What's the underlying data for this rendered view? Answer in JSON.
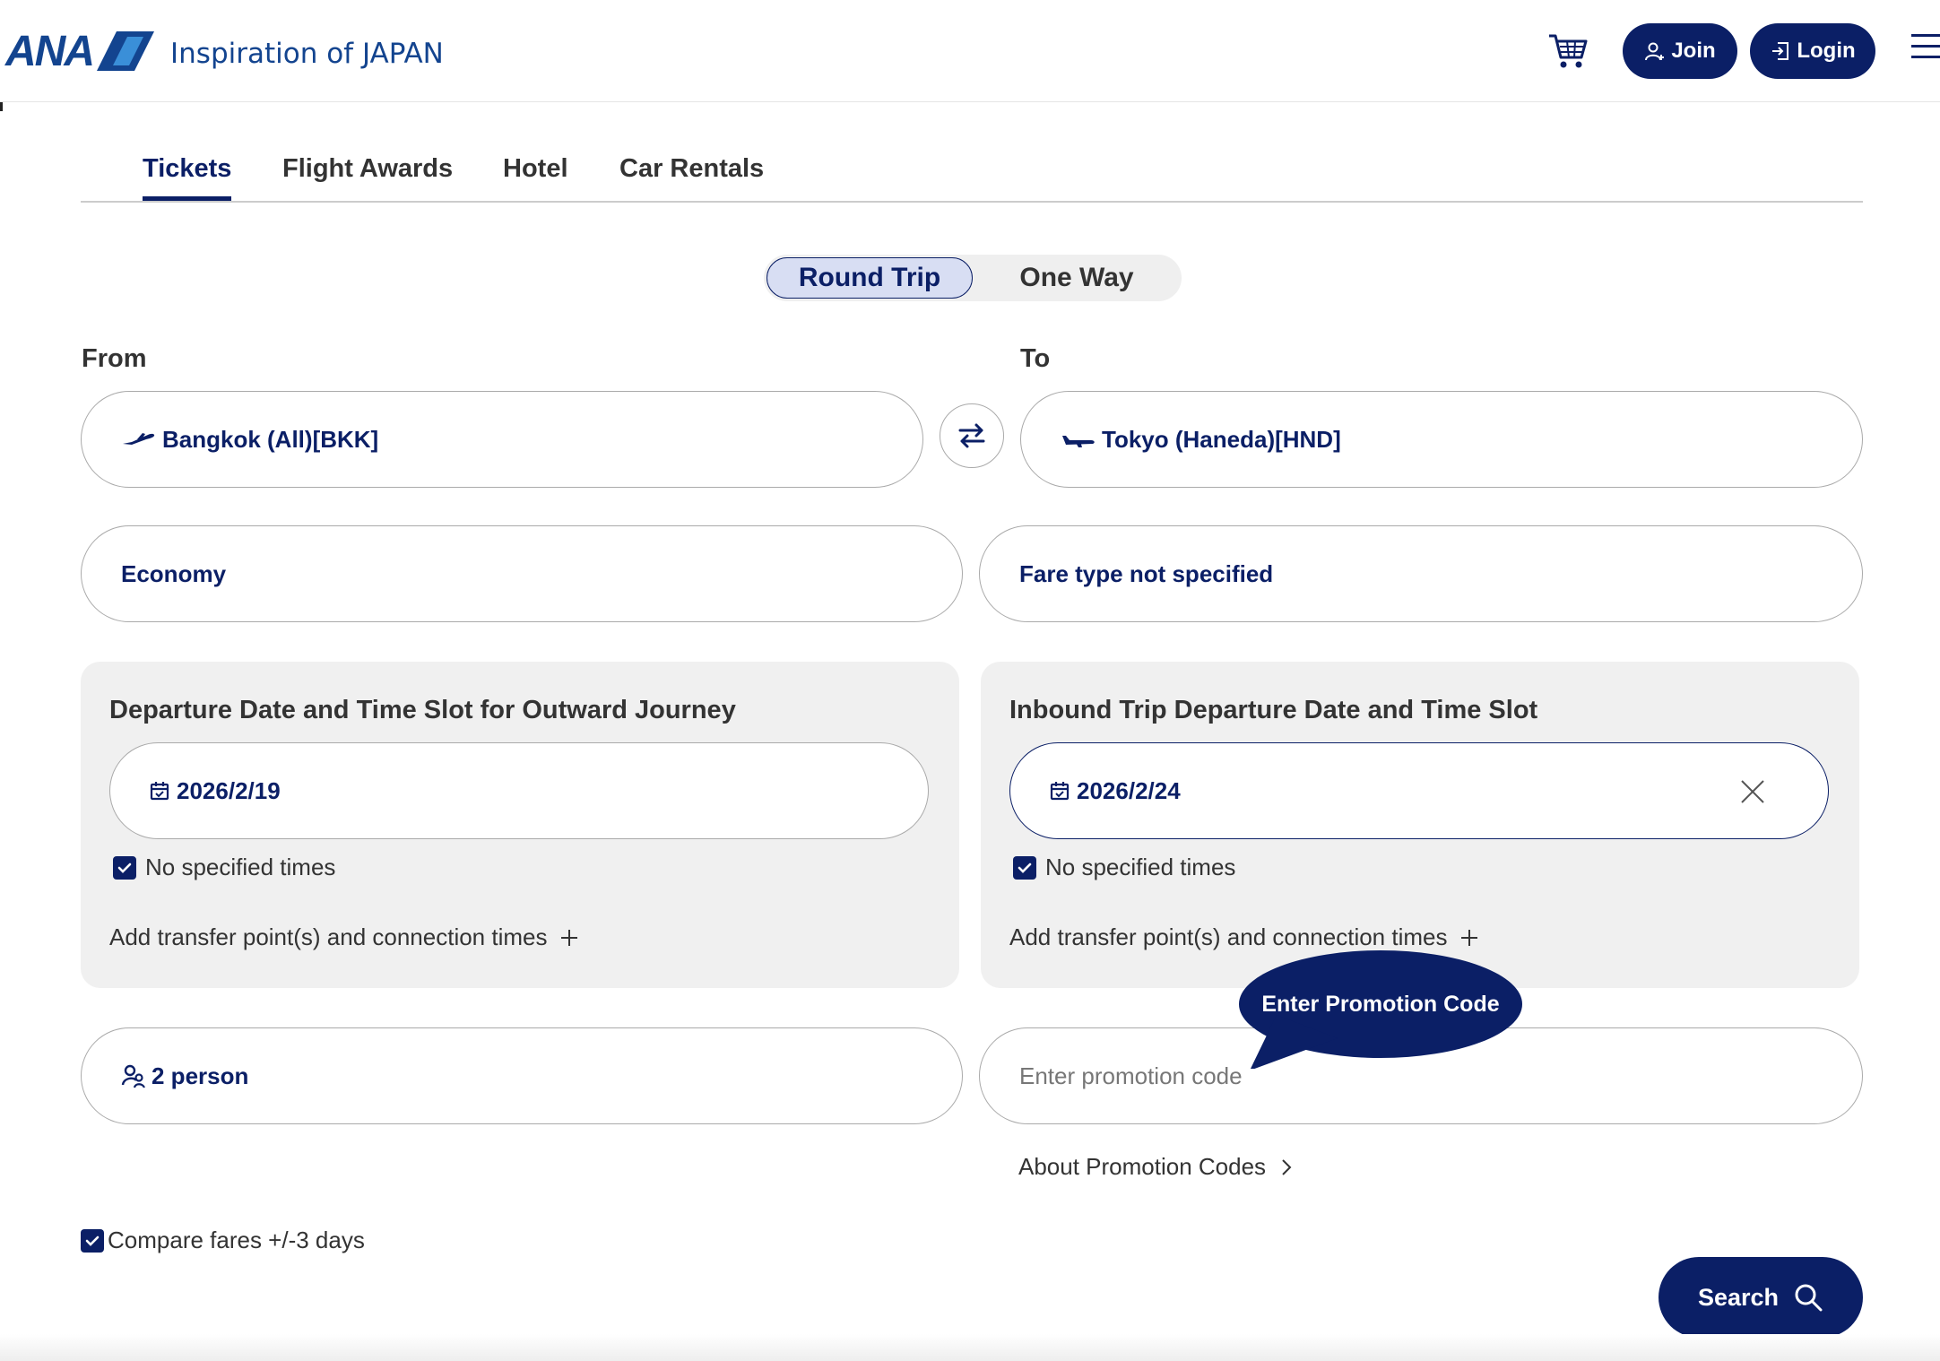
{
  "header": {
    "logo_text": "ANA",
    "tagline": "Inspiration of JAPAN",
    "join_label": "Join",
    "login_label": "Login",
    "brand_color": "#13448f",
    "accent_color": "#0b1f66"
  },
  "tabs": [
    {
      "label": "Tickets",
      "active": true
    },
    {
      "label": "Flight Awards",
      "active": false
    },
    {
      "label": "Hotel",
      "active": false
    },
    {
      "label": "Car Rentals",
      "active": false
    }
  ],
  "trip_type": {
    "options": [
      "Round Trip",
      "One Way"
    ],
    "selected": "Round Trip"
  },
  "route": {
    "from_label": "From",
    "from_value": "Bangkok (All)[BKK]",
    "to_label": "To",
    "to_value": "Tokyo (Haneda)[HND]"
  },
  "cabin": {
    "value": "Economy"
  },
  "fare_type": {
    "value": "Fare type not specified"
  },
  "outbound": {
    "title": "Departure Date and Time Slot for Outward Journey",
    "date": "2026/2/19",
    "no_times_label": "No specified times",
    "no_times_checked": true,
    "transfer_label": "Add transfer point(s) and connection times"
  },
  "inbound": {
    "title": "Inbound Trip Departure Date and Time Slot",
    "date": "2026/2/24",
    "no_times_label": "No specified times",
    "no_times_checked": true,
    "transfer_label": "Add transfer point(s) and connection times"
  },
  "passengers": {
    "value": "2 person"
  },
  "promo": {
    "placeholder": "Enter promotion code",
    "tooltip": "Enter Promotion Code",
    "about_label": "About Promotion Codes"
  },
  "compare": {
    "label": "Compare fares +/-3 days",
    "checked": true
  },
  "search": {
    "label": "Search"
  },
  "icons": [
    "cart-icon",
    "user-plus-icon",
    "login-icon",
    "hamburger-menu-icon",
    "plane-takeoff-icon",
    "swap-icon",
    "plane-landing-icon",
    "calendar-icon",
    "clear-icon",
    "checkbox-checked-icon",
    "plus-icon",
    "passenger-icon",
    "chevron-right-icon",
    "search-icon"
  ]
}
